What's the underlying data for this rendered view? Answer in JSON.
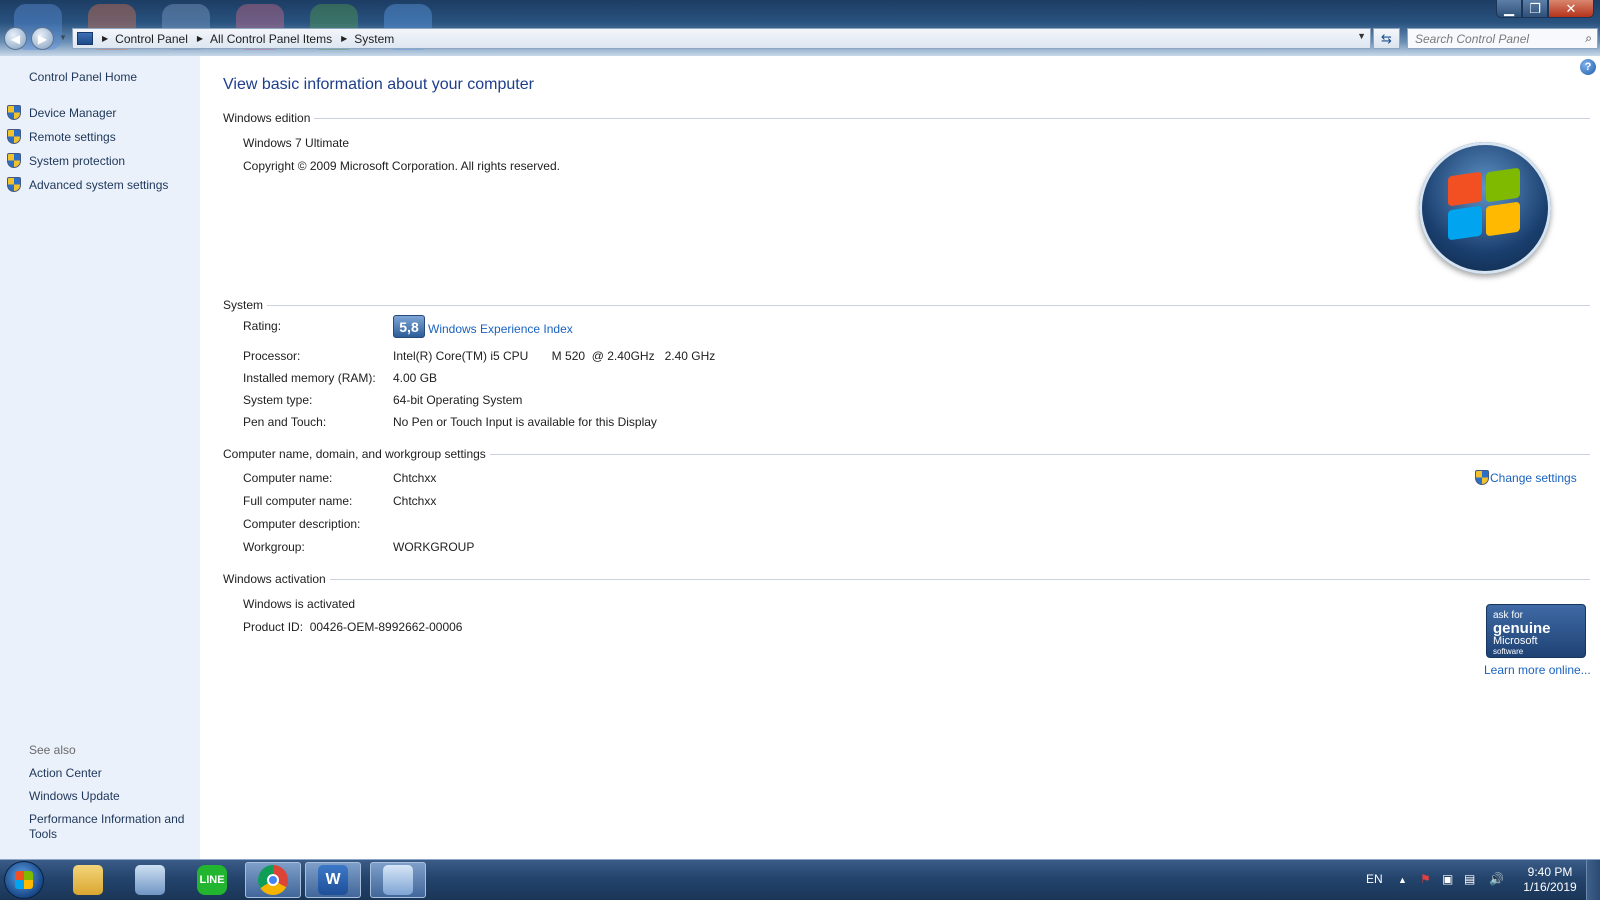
{
  "window": {
    "minimize_glyph": "▁",
    "restore_glyph": "❐",
    "close_glyph": "✕"
  },
  "address": {
    "crumbs": [
      "Control Panel",
      "All Control Panel Items",
      "System"
    ],
    "search_placeholder": "Search Control Panel"
  },
  "left_pane": {
    "home": "Control Panel Home",
    "tasks": [
      "Device Manager",
      "Remote settings",
      "System protection",
      "Advanced system settings"
    ],
    "see_also_label": "See also",
    "see_also": [
      "Action Center",
      "Windows Update",
      "Performance Information and Tools"
    ]
  },
  "main": {
    "title": "View basic information about your computer",
    "edition": {
      "heading": "Windows edition",
      "name": "Windows 7 Ultimate",
      "copyright": "Copyright © 2009 Microsoft Corporation.  All rights reserved."
    },
    "system": {
      "heading": "System",
      "rating_label": "Rating:",
      "rating_score": "5,8",
      "rating_link": "Windows Experience Index",
      "rows": [
        {
          "label": "Processor:",
          "value": "Intel(R) Core(TM) i5 CPU       M 520  @ 2.40GHz   2.40 GHz"
        },
        {
          "label": "Installed memory (RAM):",
          "value": "4.00 GB"
        },
        {
          "label": "System type:",
          "value": "64-bit Operating System"
        },
        {
          "label": "Pen and Touch:",
          "value": "No Pen or Touch Input is available for this Display"
        }
      ]
    },
    "computer": {
      "heading": "Computer name, domain, and workgroup settings",
      "change_link": "Change settings",
      "rows": [
        {
          "label": "Computer name:",
          "value": "Chtchxx"
        },
        {
          "label": "Full computer name:",
          "value": "Chtchxx"
        },
        {
          "label": "Computer description:",
          "value": ""
        },
        {
          "label": "Workgroup:",
          "value": "WORKGROUP"
        }
      ]
    },
    "activation": {
      "heading": "Windows activation",
      "status": "Windows is activated",
      "product_id": "Product ID:  00426-OEM-8992662-00006",
      "genuine_small1": "ask for",
      "genuine_big": "genuine",
      "genuine_mid": "Microsoft",
      "genuine_small2": "software",
      "learn_more": "Learn more online..."
    }
  },
  "taskbar": {
    "apps": [
      "explorer",
      "remote-desktop",
      "line",
      "chrome",
      "word",
      "control-panel"
    ],
    "line_label": "LINE",
    "word_label": "W",
    "language": "EN",
    "time": "9:40 PM",
    "date": "1/16/2019"
  },
  "colors": {
    "accent_link": "#1a62c0",
    "title_blue": "#1e3e8c",
    "left_pane_bg": "#eaf1fa"
  }
}
